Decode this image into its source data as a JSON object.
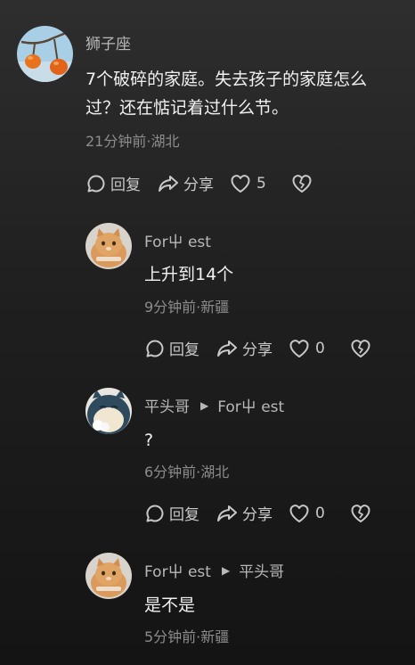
{
  "comments": [
    {
      "username": "狮子座",
      "content": "7个破碎的家庭。失去孩子的家庭怎么过？还在惦记着过什么节。",
      "meta": "21分钟前·湖北",
      "reply_label": "回复",
      "share_label": "分享",
      "likes": "5",
      "avatar": "persimmon-branch"
    },
    {
      "username": "For屮 est",
      "content": "上升到14个",
      "meta": "9分钟前·新疆",
      "reply_label": "回复",
      "share_label": "分享",
      "likes": "0",
      "avatar": "orange-cat"
    },
    {
      "username": "平头哥",
      "reply_to": "For屮 est",
      "content": "?",
      "meta": "6分钟前·湖北",
      "reply_label": "回复",
      "share_label": "分享",
      "likes": "0",
      "avatar": "snorlax"
    },
    {
      "username": "For屮 est",
      "reply_to": "平头哥",
      "content": "是不是",
      "meta": "5分钟前·新疆",
      "avatar": "orange-cat"
    }
  ]
}
